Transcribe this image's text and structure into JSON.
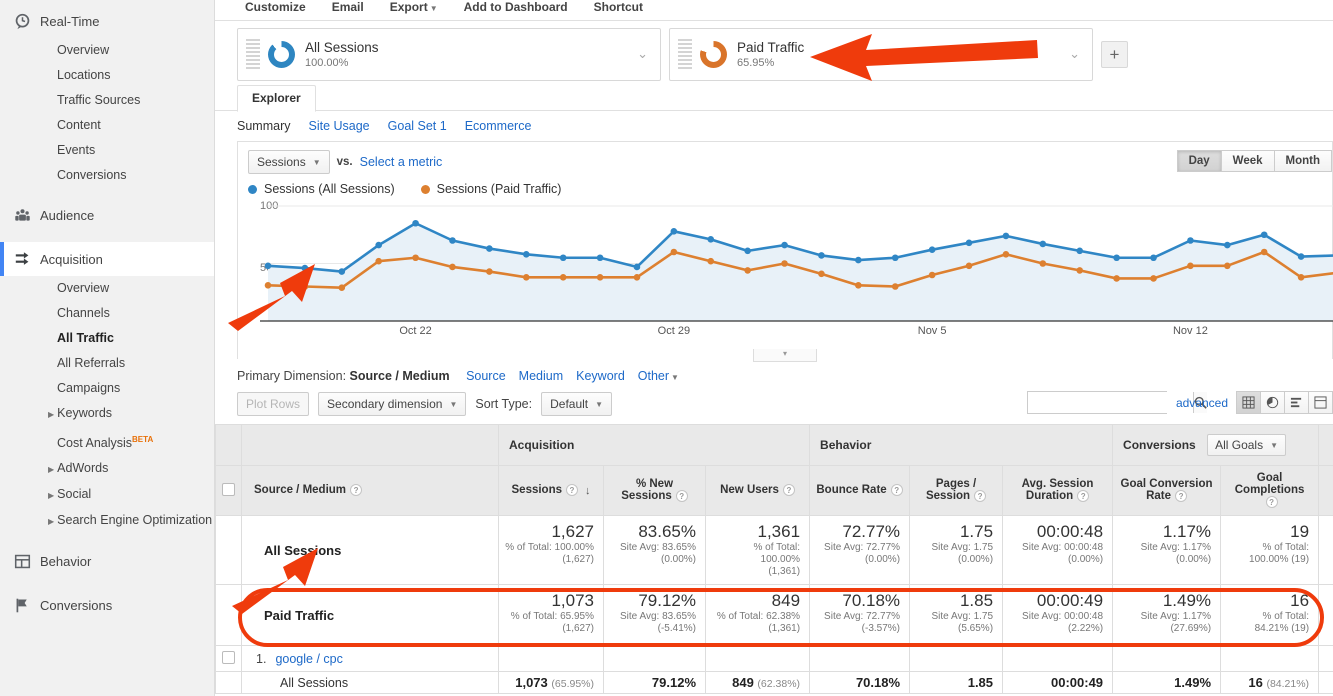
{
  "sidebar": {
    "groups": [
      {
        "label": "Real-Time",
        "icon": "realtime-clock-icon",
        "active": false,
        "items": [
          {
            "label": "Overview"
          },
          {
            "label": "Locations"
          },
          {
            "label": "Traffic Sources"
          },
          {
            "label": "Content"
          },
          {
            "label": "Events"
          },
          {
            "label": "Conversions"
          }
        ]
      },
      {
        "label": "Audience",
        "icon": "audience-people-icon",
        "active": false,
        "items": []
      },
      {
        "label": "Acquisition",
        "icon": "acquisition-arrows-icon",
        "active": true,
        "items": [
          {
            "label": "Overview"
          },
          {
            "label": "Channels"
          },
          {
            "label": "All Traffic",
            "bold": true
          },
          {
            "label": "All Referrals"
          },
          {
            "label": "Campaigns"
          },
          {
            "label": "Keywords",
            "expandable": true
          },
          {
            "label": "Cost Analysis",
            "badge": "BETA"
          },
          {
            "label": "AdWords",
            "expandable": true
          },
          {
            "label": "Social",
            "expandable": true
          },
          {
            "label": "Search Engine Optimization",
            "expandable": true
          }
        ]
      },
      {
        "label": "Behavior",
        "icon": "behavior-grid-icon",
        "active": false,
        "items": []
      },
      {
        "label": "Conversions",
        "icon": "conversions-flag-icon",
        "active": false,
        "items": []
      }
    ]
  },
  "toolbar": {
    "items": [
      {
        "label": "Customize",
        "caret": false
      },
      {
        "label": "Email",
        "caret": false
      },
      {
        "label": "Export",
        "caret": true
      },
      {
        "label": "Add to Dashboard",
        "caret": false
      },
      {
        "label": "Shortcut",
        "caret": false
      }
    ]
  },
  "segments": {
    "cards": [
      {
        "name": "All Sessions",
        "percent": "100.00%",
        "color": "#2e86c1"
      },
      {
        "name": "Paid Traffic",
        "percent": "65.95%",
        "color": "#d9742a"
      }
    ],
    "add_label": "+"
  },
  "explorer": {
    "tab_label": "Explorer",
    "subtabs": [
      {
        "label": "Summary",
        "selected": true
      },
      {
        "label": "Site Usage",
        "selected": false
      },
      {
        "label": "Goal Set 1",
        "selected": false
      },
      {
        "label": "Ecommerce",
        "selected": false
      }
    ]
  },
  "graph_controls": {
    "metric_button": "Sessions",
    "vs_label": "vs.",
    "select_metric": "Select a metric",
    "granularity": [
      {
        "label": "Day",
        "selected": true
      },
      {
        "label": "Week",
        "selected": false
      },
      {
        "label": "Month",
        "selected": false
      }
    ]
  },
  "chart_data": {
    "type": "line",
    "title": "",
    "xlabel": "",
    "ylabel": "Sessions",
    "ylim": [
      0,
      100
    ],
    "yticks": [
      50,
      100
    ],
    "grid": true,
    "legend_position": "top-left",
    "legend": [
      "Sessions (All Sessions)",
      "Sessions (Paid Traffic)"
    ],
    "xticks": [
      "Oct 22",
      "Oct 29",
      "Nov 5",
      "Nov 12"
    ],
    "xtick_indices": [
      4,
      11,
      18,
      25
    ],
    "colors": {
      "all_sessions": "#2f86c5",
      "paid_traffic": "#dd8030"
    },
    "series": [
      {
        "name": "Sessions (All Sessions)",
        "values": [
          48,
          46,
          43,
          66,
          85,
          70,
          63,
          58,
          55,
          55,
          47,
          78,
          71,
          61,
          66,
          57,
          53,
          55,
          62,
          68,
          74,
          67,
          61,
          55,
          55,
          70,
          66,
          75,
          56,
          57
        ]
      },
      {
        "name": "Sessions (Paid Traffic)",
        "values": [
          31,
          30,
          29,
          52,
          55,
          47,
          43,
          38,
          38,
          38,
          38,
          60,
          52,
          44,
          50,
          41,
          31,
          30,
          40,
          48,
          58,
          50,
          44,
          37,
          37,
          48,
          48,
          60,
          38,
          42
        ]
      }
    ]
  },
  "primary_dimension": {
    "label": "Primary Dimension:",
    "selected": "Source / Medium",
    "options": [
      {
        "label": "Source"
      },
      {
        "label": "Medium"
      },
      {
        "label": "Keyword"
      },
      {
        "label": "Other",
        "caret": true
      }
    ]
  },
  "table_controls": {
    "plot_rows": "Plot Rows",
    "secondary_dimension": "Secondary dimension",
    "sort_type_label": "Sort Type:",
    "sort_type_value": "Default",
    "search_placeholder": "",
    "search_value": "",
    "advanced": "advanced",
    "view_icons": [
      "table-view-icon",
      "pie-view-icon",
      "bar-view-icon",
      "pivot-view-icon"
    ]
  },
  "table": {
    "dimension_header": "Source / Medium",
    "groups": [
      {
        "label": "Acquisition",
        "span": 3
      },
      {
        "label": "Behavior",
        "span": 3
      },
      {
        "label": "Conversions",
        "span": 3,
        "select": "All Goals"
      }
    ],
    "columns": [
      {
        "label": "Sessions",
        "help": true,
        "sorted": true
      },
      {
        "label": "% New Sessions",
        "help": true
      },
      {
        "label": "New Users",
        "help": true
      },
      {
        "label": "Bounce Rate",
        "help": true
      },
      {
        "label": "Pages / Session",
        "help": true
      },
      {
        "label": "Avg. Session Duration",
        "help": true
      },
      {
        "label": "Goal Conversion Rate",
        "help": true
      },
      {
        "label": "Goal Completions",
        "help": true
      }
    ],
    "rows": [
      {
        "name": "All Sessions",
        "highlight": false,
        "cells": [
          {
            "big": "1,627",
            "sub1": "% of Total: 100.00%",
            "sub2": "(1,627)"
          },
          {
            "big": "83.65%",
            "sub1": "Site Avg: 83.65%",
            "sub2": "(0.00%)"
          },
          {
            "big": "1,361",
            "sub1": "% of Total: 100.00%",
            "sub2": "(1,361)"
          },
          {
            "big": "72.77%",
            "sub1": "Site Avg: 72.77%",
            "sub2": "(0.00%)"
          },
          {
            "big": "1.75",
            "sub1": "Site Avg: 1.75",
            "sub2": "(0.00%)"
          },
          {
            "big": "00:00:48",
            "sub1": "Site Avg: 00:00:48",
            "sub2": "(0.00%)"
          },
          {
            "big": "1.17%",
            "sub1": "Site Avg: 1.17%",
            "sub2": "(0.00%)"
          },
          {
            "big": "19",
            "sub1": "% of Total:",
            "sub2": "100.00% (19)"
          }
        ]
      },
      {
        "name": "Paid Traffic",
        "highlight": true,
        "cells": [
          {
            "big": "1,073",
            "sub1": "% of Total: 65.95%",
            "sub2": "(1,627)"
          },
          {
            "big": "79.12%",
            "sub1": "Site Avg: 83.65%",
            "sub2": "(-5.41%)"
          },
          {
            "big": "849",
            "sub1": "% of Total: 62.38%",
            "sub2": "(1,361)"
          },
          {
            "big": "70.18%",
            "sub1": "Site Avg: 72.77%",
            "sub2": "(-3.57%)"
          },
          {
            "big": "1.85",
            "sub1": "Site Avg: 1.75",
            "sub2": "(5.65%)"
          },
          {
            "big": "00:00:49",
            "sub1": "Site Avg: 00:00:48",
            "sub2": "(2.22%)"
          },
          {
            "big": "1.49%",
            "sub1": "Site Avg: 1.17%",
            "sub2": "(27.69%)"
          },
          {
            "big": "16",
            "sub1": "% of Total:",
            "sub2": "84.21% (19)"
          }
        ]
      }
    ],
    "detail_row": {
      "index": "1.",
      "link": "google / cpc"
    },
    "detail_sub": {
      "name": "All Sessions",
      "cells": [
        {
          "v": "1,073",
          "p": "(65.95%)"
        },
        {
          "v": "79.12%",
          "p": ""
        },
        {
          "v": "849",
          "p": "(62.38%)"
        },
        {
          "v": "70.18%",
          "p": ""
        },
        {
          "v": "1.85",
          "p": ""
        },
        {
          "v": "00:00:49",
          "p": ""
        },
        {
          "v": "1.49%",
          "p": ""
        },
        {
          "v": "16",
          "p": "(84.21%)"
        }
      ]
    }
  },
  "annotations": {
    "accent_color": "#ef3b0c",
    "arrows": [
      {
        "name": "arrow-to-paid-traffic-segment"
      },
      {
        "name": "arrow-to-chart-paid-line"
      },
      {
        "name": "arrow-to-paid-traffic-row"
      }
    ],
    "highlight_ring": {
      "name": "paid-traffic-row-highlight"
    }
  }
}
